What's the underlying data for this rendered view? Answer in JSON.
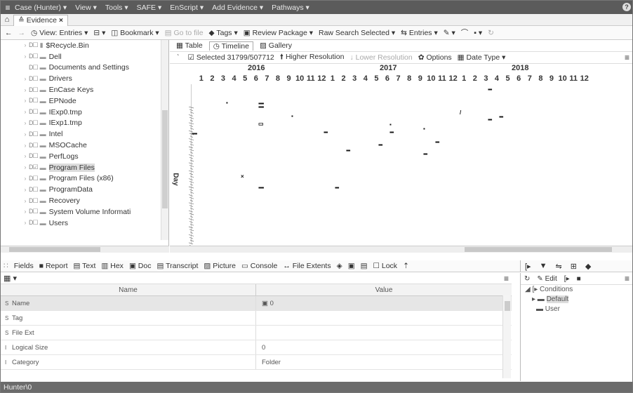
{
  "menubar": {
    "items": [
      "Case (Hunter) ▾",
      "View ▾",
      "Tools ▾",
      "SAFE ▾",
      "EnScript ▾",
      "Add Evidence ▾",
      "Pathways ▾"
    ],
    "help": "?"
  },
  "tabs": {
    "evidence": "Evidence"
  },
  "toolbar": {
    "view_entries": "View: Entries ▾",
    "bookmark": "Bookmark ▾",
    "go_to_file": "Go to file",
    "tags": "Tags ▾",
    "review_package": "Review Package ▾",
    "raw_search": "Raw Search Selected ▾",
    "entries": "Entries ▾"
  },
  "tree": {
    "items": [
      {
        "label": "$Recycle.Bin",
        "checked": false
      },
      {
        "label": "Dell",
        "checked": false
      },
      {
        "label": "Documents and Settings",
        "checked": false
      },
      {
        "label": "Drivers",
        "checked": false
      },
      {
        "label": "EnCase Keys",
        "checked": false
      },
      {
        "label": "EPNode",
        "checked": false
      },
      {
        "label": "IExp0.tmp",
        "checked": false
      },
      {
        "label": "IExp1.tmp",
        "checked": false
      },
      {
        "label": "Intel",
        "checked": false
      },
      {
        "label": "MSOCache",
        "checked": false
      },
      {
        "label": "PerfLogs",
        "checked": false
      },
      {
        "label": "Program Files",
        "checked": true
      },
      {
        "label": "Program Files (x86)",
        "checked": false
      },
      {
        "label": "ProgramData",
        "checked": false
      },
      {
        "label": "Recovery",
        "checked": false
      },
      {
        "label": "System Volume Informati",
        "checked": false
      },
      {
        "label": "Users",
        "checked": false
      }
    ]
  },
  "timeline": {
    "view_tabs": [
      "Table",
      "Timeline",
      "Gallery"
    ],
    "selected": "Selected 31799/507712",
    "higher": "Higher Resolution",
    "lower": "Lower Resolution",
    "options": "Options",
    "date_type": "Date Type ▾",
    "years": [
      "2016",
      "2017",
      "2018"
    ],
    "months": [
      "1",
      "2",
      "3",
      "4",
      "5",
      "6",
      "7",
      "8",
      "9",
      "10",
      "11",
      "12",
      "1",
      "2",
      "3",
      "4",
      "5",
      "6",
      "7",
      "8",
      "9",
      "10",
      "11",
      "12",
      "1",
      "2",
      "3",
      "4",
      "5",
      "6",
      "7",
      "8",
      "9",
      "10",
      "11",
      "12"
    ],
    "day_label": "Day"
  },
  "panel_tabs": [
    "Fields",
    "Report",
    "Text",
    "Hex",
    "Doc",
    "Transcript",
    "Picture",
    "Console",
    "File Extents",
    "Lock"
  ],
  "fields": {
    "headers": [
      "Name",
      "Value"
    ],
    "rows": [
      {
        "type": "S",
        "name": "Name",
        "value": "0"
      },
      {
        "type": "S",
        "name": "Tag",
        "value": ""
      },
      {
        "type": "S",
        "name": "File Ext",
        "value": ""
      },
      {
        "type": "I",
        "name": "Logical Size",
        "value": "0"
      },
      {
        "type": "I",
        "name": "Category",
        "value": "Folder"
      }
    ]
  },
  "conditions": {
    "edit": "Edit",
    "root": "Conditions",
    "default": "Default",
    "user": "User"
  },
  "status": "Hunter\\0"
}
